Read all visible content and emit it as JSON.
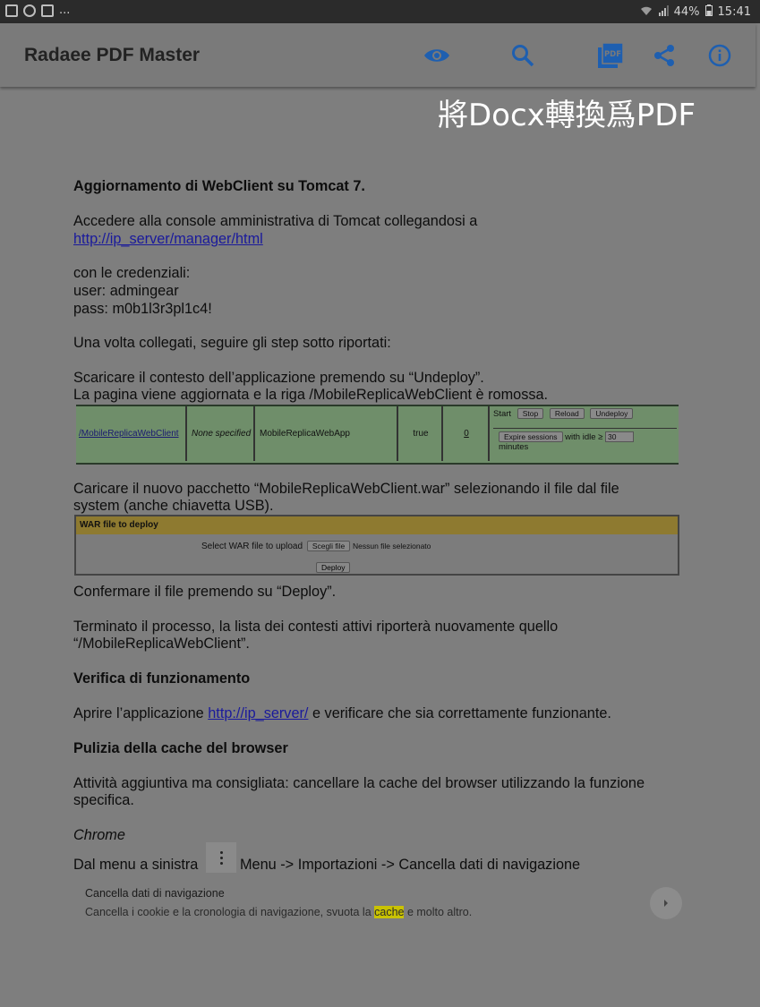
{
  "status_bar": {
    "left_text": "...",
    "battery": "44%",
    "time": "15:41"
  },
  "app_bar": {
    "title": "Radaee PDF Master",
    "actions": [
      "eye-icon",
      "search-icon",
      "pdf-icon",
      "share-icon",
      "info-icon"
    ]
  },
  "watermark": "將Docx轉換爲PDF",
  "document": {
    "heading1": "Aggiornamento di WebClient su Tomcat 7.",
    "access_line": "Accedere alla console amministrativa di Tomcat collegandosi a",
    "access_link": "http://ip_server/manager/html",
    "cred_intro": "con le credenziali:",
    "cred_user": "user: admingear",
    "cred_pass": "pass: m0b1l3r3pl1c4!",
    "once_connected": "Una volta collegati, seguire gli step sotto riportati:",
    "download_line": "Scaricare il contesto dell’applicazione premendo su “Undeploy”.",
    "reload_line": "La pagina viene aggiornata e la riga /MobileReplicaWebClient è romossa.",
    "upload_line1": "Caricare il nuovo pacchetto “MobileReplicaWebClient.war” selezionando il file dal file",
    "upload_line2": "system (anche chiavetta USB).",
    "confirm_line": "Confermare il file premendo su “Deploy”.",
    "terminated_line1": "Terminato il processo, la lista dei contesti attivi riporterà nuovamente quello",
    "terminated_line2": "“/MobileReplicaWebClient”.",
    "heading2": "Verifica di funzionamento",
    "open_app_prefix": "Aprire l’applicazione ",
    "open_app_link": "http://ip_server/",
    "open_app_suffix": " e verificare che sia correttamente funzionante.",
    "heading3": "Pulizia della cache del browser",
    "activity_line1": "Attività aggiuntiva ma consigliata: cancellare la cache del browser utilizzando la funzione",
    "activity_line2": "specifica.",
    "chrome_label": "Chrome",
    "menu_prefix": "Dal menu a sinistra",
    "menu_suffix": "Menu -> Importazioni -> Cancella dati di navigazione",
    "chrome_card_title": "Cancella dati di navigazione",
    "chrome_card_text_before": "Cancella i cookie e la cronologia di navigazione, svuota la ",
    "chrome_card_highlight": "cache",
    "chrome_card_text_after": " e molto altro."
  },
  "tomcat_row": {
    "path": "/MobileReplicaWebClient",
    "version": "None specified",
    "display_name": "MobileReplicaWebApp",
    "running": "true",
    "sessions": "0",
    "start": "Start",
    "stop": "Stop",
    "reload": "Reload",
    "undeploy": "Undeploy",
    "expire": "Expire sessions",
    "idle_label": "with idle ≥",
    "idle_value": "30",
    "minutes": "minutes"
  },
  "war_panel": {
    "header": "WAR file to deploy",
    "select_label": "Select WAR file to upload",
    "choose_button": "Scegli file",
    "no_file": "Nessun file selezionato",
    "deploy_button": "Deploy"
  },
  "colors": {
    "accent_icon": "#1e5fb0",
    "status_bar": "#2b2b2b",
    "app_bar": "#7a7a7a",
    "page": "#7e7e7e",
    "green_row": "#6f8e6a",
    "war_header": "#8e7a30",
    "highlight": "#c9c200"
  }
}
